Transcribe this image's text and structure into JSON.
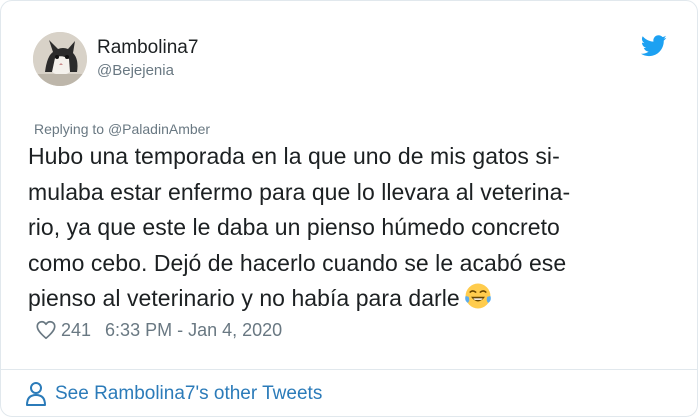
{
  "user": {
    "display_name": "Rambolina7",
    "handle": "@Bejejenia",
    "avatar_icon": "cat-avatar"
  },
  "reply": {
    "prefix": "Replying to",
    "mention": "@PaladinAmber"
  },
  "tweet": {
    "lines": [
      "Hubo una temporada en la que uno de mis gatos si-",
      "mulaba estar enfermo para que lo llevara al veterina-",
      "rio, ya que este le daba un pienso húmedo concreto",
      "como cebo. Dejó de hacerlo cuando se le acabó ese",
      "pienso al veterinario y no había para darle"
    ],
    "emoji": "face-with-tears-of-joy"
  },
  "meta": {
    "likes": "241",
    "timestamp": "6:33 PM - Jan 4, 2020"
  },
  "footer": {
    "see_more": "See Rambolina7's other Tweets"
  },
  "colors": {
    "link": "#2b7bb9",
    "muted": "#697882",
    "twitter_blue": "#1da1f2",
    "text": "#1c2022"
  }
}
